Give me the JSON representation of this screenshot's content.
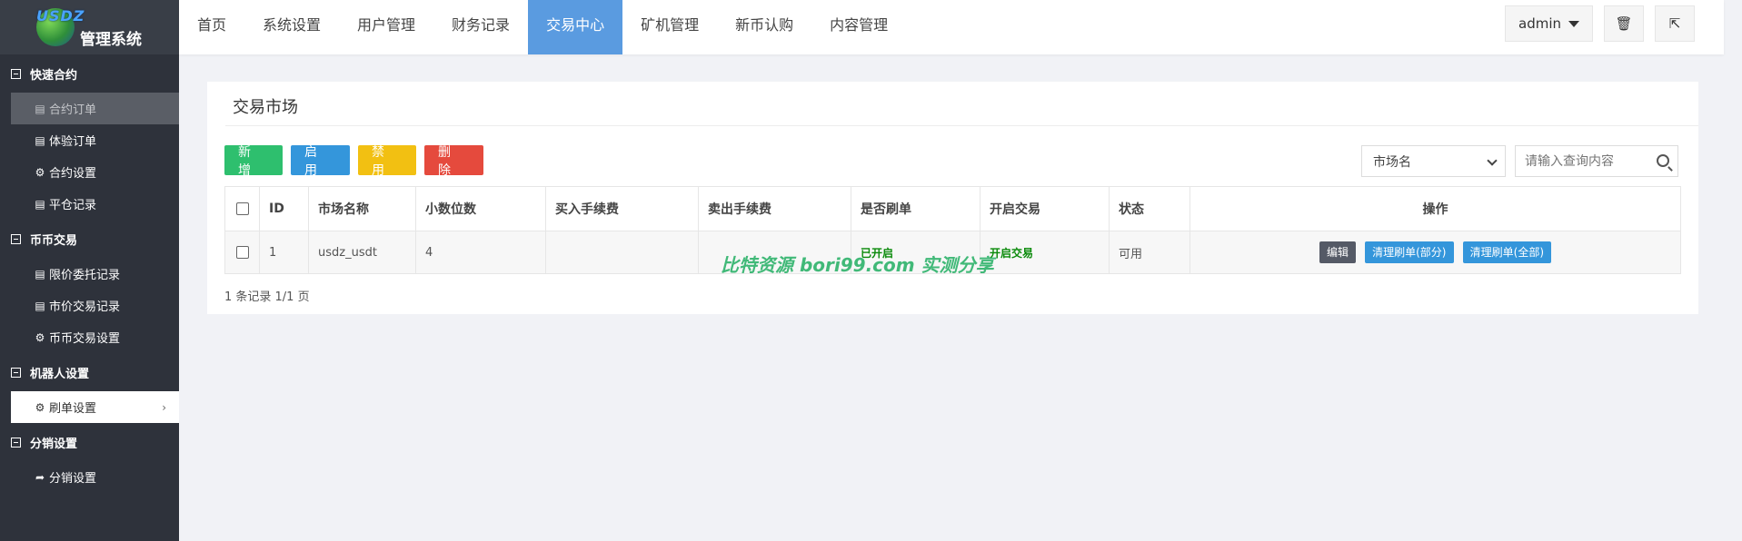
{
  "app": {
    "logo_text": "USDZ",
    "title": "管理系统"
  },
  "sidebar": {
    "groups": [
      {
        "label": "快速合约",
        "items": [
          {
            "label": "合约订单",
            "icon": "list-icon"
          },
          {
            "label": "体验订单",
            "icon": "list-icon"
          },
          {
            "label": "合约设置",
            "icon": "gear-icon"
          },
          {
            "label": "平仓记录",
            "icon": "list-icon"
          }
        ]
      },
      {
        "label": "币币交易",
        "items": [
          {
            "label": "限价委托记录",
            "icon": "list-icon"
          },
          {
            "label": "市价交易记录",
            "icon": "list-icon"
          },
          {
            "label": "币币交易设置",
            "icon": "gear-icon"
          }
        ]
      },
      {
        "label": "机器人设置",
        "items": [
          {
            "label": "刷单设置",
            "icon": "gear-icon"
          }
        ]
      },
      {
        "label": "分销设置",
        "items": [
          {
            "label": "分销设置",
            "icon": "share-icon"
          }
        ]
      }
    ]
  },
  "topnav": {
    "tabs": [
      "首页",
      "系统设置",
      "用户管理",
      "财务记录",
      "交易中心",
      "矿机管理",
      "新币认购",
      "内容管理"
    ],
    "active": "交易中心",
    "user": "admin"
  },
  "panel": {
    "title": "交易市场",
    "buttons": {
      "add": "新 增",
      "enable": "启 用",
      "disable": "禁 用",
      "delete": "删 除"
    },
    "search": {
      "select_value": "市场名",
      "placeholder": "请输入查询内容"
    },
    "table": {
      "headers": [
        "ID",
        "市场名称",
        "小数位数",
        "买入手续费",
        "卖出手续费",
        "是否刷单",
        "开启交易",
        "状态",
        "操作"
      ],
      "rows": [
        {
          "id": "1",
          "market": "usdz_usdt",
          "decimals": "4",
          "buy_fee": "",
          "sell_fee": "",
          "brush": "已开启",
          "trade": "开启交易",
          "status": "可用",
          "ops": {
            "edit": "编辑",
            "clear_partial": "清理刷单(部分)",
            "clear_all": "清理刷单(全部)"
          }
        }
      ]
    },
    "pager": "1 条记录 1/1 页"
  },
  "watermark": "比特资源 bori99.com 实测分享",
  "colors": {
    "accent": "#5a9be0",
    "sidebar_bg": "#2e323b",
    "green": "#2ebf6e",
    "red": "#e54a3d",
    "yellow": "#f2c012",
    "blue": "#3496db"
  }
}
